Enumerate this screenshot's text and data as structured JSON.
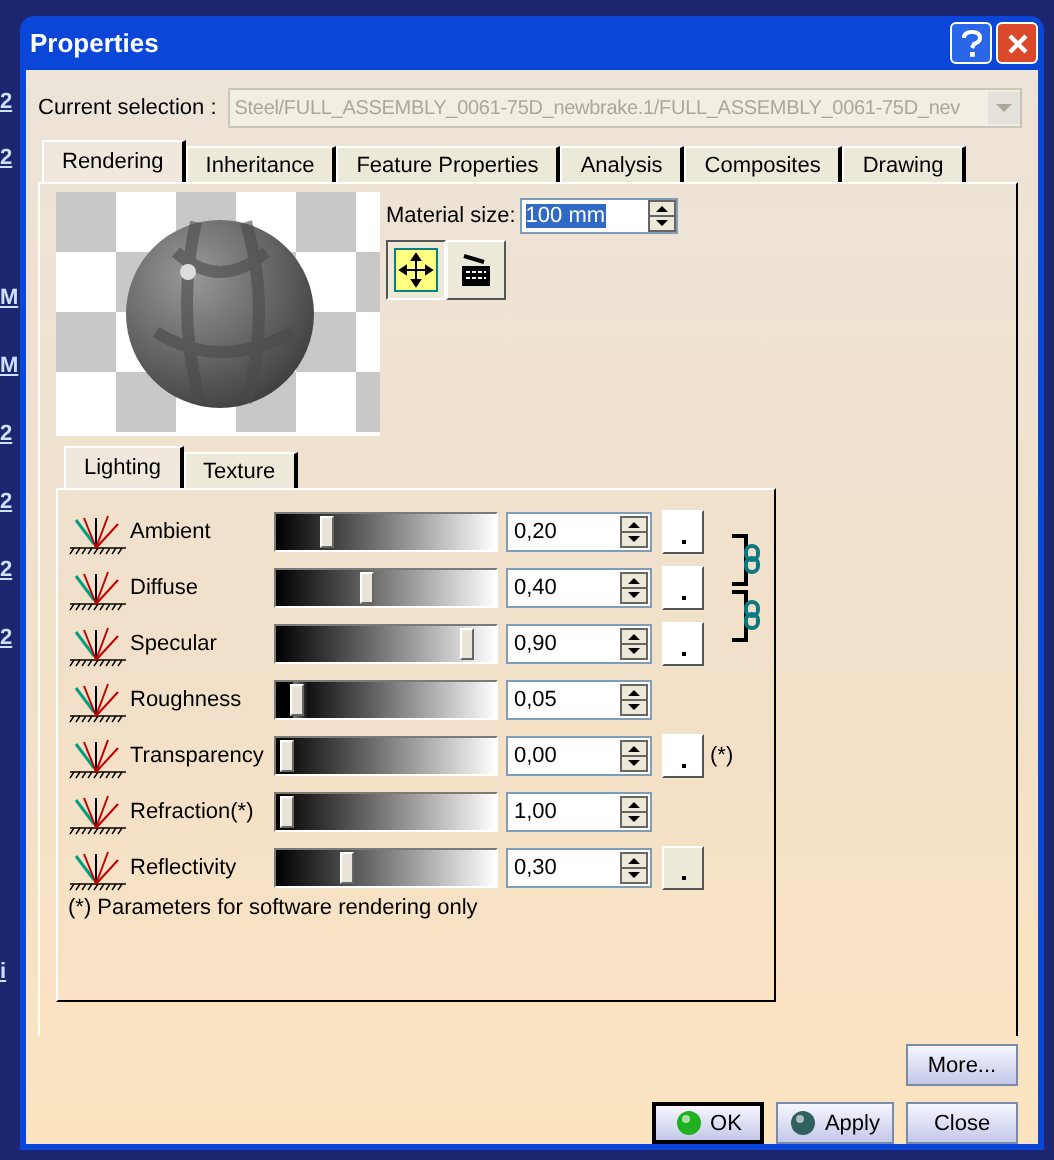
{
  "background_fragments": [
    "2",
    "2",
    "M",
    "M",
    "2",
    "2",
    "2",
    "2",
    "i"
  ],
  "window": {
    "title": "Properties"
  },
  "selection": {
    "label": "Current selection :",
    "value": "Steel/FULL_ASSEMBLY_0061-75D_newbrake.1/FULL_ASSEMBLY_0061-75D_nev",
    "disabled": true
  },
  "tabs": [
    {
      "label": "Rendering",
      "selected": true
    },
    {
      "label": "Inheritance",
      "selected": false
    },
    {
      "label": "Feature Properties",
      "selected": false
    },
    {
      "label": "Analysis",
      "selected": false
    },
    {
      "label": "Composites",
      "selected": false
    },
    {
      "label": "Drawing",
      "selected": false
    }
  ],
  "material_size": {
    "label": "Material size:",
    "value": "100 mm"
  },
  "mapping_buttons": [
    {
      "kind": "move",
      "selected": true
    },
    {
      "kind": "projector",
      "selected": false
    }
  ],
  "subtabs": [
    {
      "label": "Lighting",
      "selected": true
    },
    {
      "label": "Texture",
      "selected": false
    }
  ],
  "parameters": [
    {
      "name": "Ambient",
      "level": 0.2,
      "value": "0,20",
      "color_button": true,
      "linked_to_next": true
    },
    {
      "name": "Diffuse",
      "level": 0.4,
      "value": "0,40",
      "color_button": true,
      "linked_to_next": true
    },
    {
      "name": "Specular",
      "level": 0.9,
      "value": "0,90",
      "color_button": true,
      "linked_to_next": false
    },
    {
      "name": "Roughness",
      "level": 0.05,
      "value": "0,05",
      "color_button": false,
      "linked_to_next": false
    },
    {
      "name": "Transparency",
      "level": 0.0,
      "value": "0,00",
      "color_button": true,
      "note": "(*)",
      "linked_to_next": false
    },
    {
      "name": "Refraction(*)",
      "level": 0.0,
      "value": "1,00",
      "color_button": false,
      "linked_to_next": false
    },
    {
      "name": "Reflectivity",
      "level": 0.3,
      "value": "0,30",
      "color_button": true,
      "linked_to_next": false
    }
  ],
  "footnote": "(*) Parameters for software rendering only",
  "buttons": [
    {
      "label": "More...",
      "kind": "plain"
    },
    {
      "label": "OK",
      "kind": "ok"
    },
    {
      "label": "Apply",
      "kind": "apply"
    },
    {
      "label": "Close",
      "kind": "plain"
    }
  ]
}
